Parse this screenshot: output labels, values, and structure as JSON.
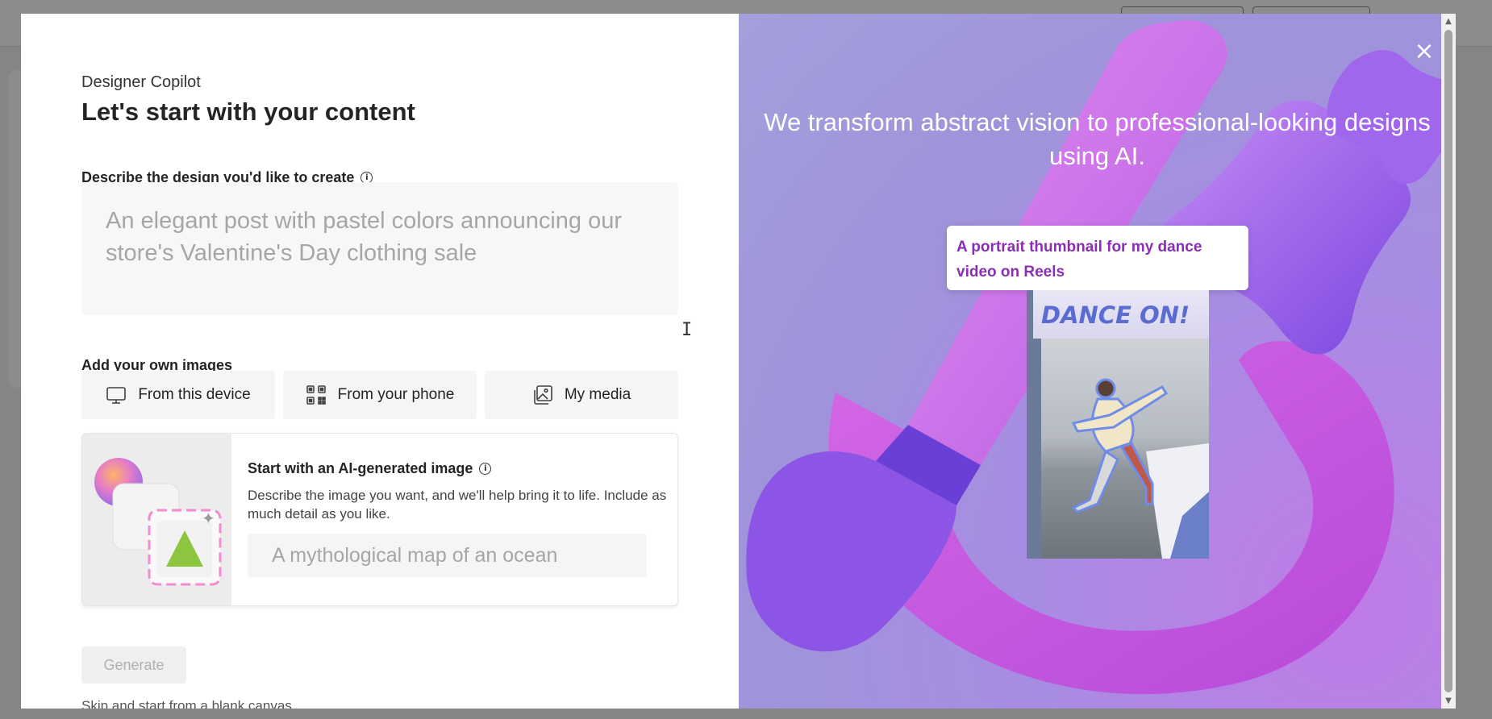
{
  "left": {
    "eyebrow": "Designer Copilot",
    "title": "Let's start with your content",
    "describe_label": "Describe the design you'd like to create",
    "describe_placeholder": "An elegant post with pastel colors announcing our store's Valentine's Day clothing sale",
    "images_label": "Add your own images",
    "image_sources": [
      {
        "label": "From this device",
        "icon": "monitor-icon"
      },
      {
        "label": "From your phone",
        "icon": "qr-code-icon"
      },
      {
        "label": "My media",
        "icon": "image-gallery-icon"
      }
    ],
    "ai_card": {
      "title": "Start with an AI-generated image",
      "description": "Describe the image you want, and we'll help bring it to life. Include as much detail as you like.",
      "placeholder": "A mythological map of an ocean"
    },
    "generate_label": "Generate",
    "skip_label": "Skip and start from a blank canvas"
  },
  "right": {
    "headline": "We transform abstract vision to professional-looking designs using AI.",
    "example_prompt": "A portrait thumbnail for my dance video on Reels",
    "poster_title": "DANCE ON!",
    "close_symbol": "×"
  },
  "colors": {
    "accent_purple": "#8a2fb4",
    "panel_background": "#a98be4"
  }
}
